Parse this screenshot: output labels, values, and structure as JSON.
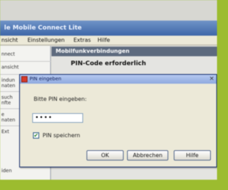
{
  "window": {
    "title": "le Mobile Connect Lite"
  },
  "menubar": {
    "items": [
      "nsicht",
      "Einstellungen",
      "Extras",
      "Hilfe"
    ]
  },
  "sidebar": {
    "items": [
      "nnect",
      "ansicht",
      "indun\nnaten",
      "such\nnfte",
      "e\nnaten",
      "Ext"
    ],
    "bottom": "iden"
  },
  "panel": {
    "header": "Mobilfunkverbindungen",
    "subtitle": "PIN-Code erforderlich"
  },
  "dialog": {
    "title": "PIN eingeben",
    "close": "×",
    "prompt": "Bitte PIN eingeben:",
    "pin_value": "••••",
    "save_pin_label": "PIN speichern",
    "save_pin_checked": true,
    "buttons": {
      "ok": "OK",
      "cancel": "Abbrechen",
      "help": "Hilfe"
    }
  },
  "colors": {
    "frame": "#9cbc2f",
    "titlebar": "#3f67a8",
    "panel_header": "#5d6a7e"
  }
}
